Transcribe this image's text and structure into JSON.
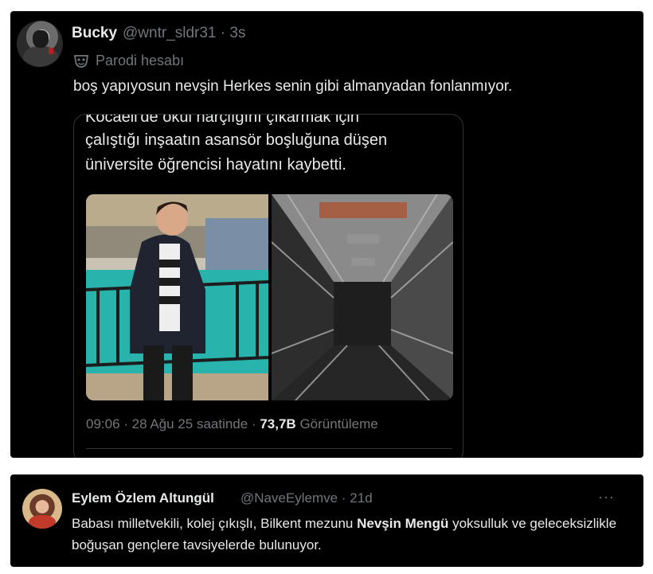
{
  "top_tweet": {
    "author": {
      "name": "Bucky",
      "handle": "@wntr_sldr31",
      "time": "3s"
    },
    "separator": "·",
    "parody_label": "Parodi hesabı",
    "text": "boş yapıyosun nevşin Herkes senin gibi almanyadan fonlanmıyor.",
    "quoted": {
      "lines": [
        "Kocaeli'de okul harçlığını çıkarmak için",
        "çalıştığı inşaatın asansör boşluğuna düşen",
        "üniversite öğrencisi hayatını kaybetti."
      ],
      "meta_time": "09:06 · 28 Ağu 25 saatinde ·",
      "views_count": "73,7B",
      "views_label": "Görüntüleme"
    }
  },
  "bottom_tweet": {
    "author": {
      "name": "Eylem Özlem Altungül",
      "handle": "@NaveEylemve",
      "time": "21d"
    },
    "separator": "·",
    "more_label": "···",
    "text_before": "Babası milletvekili, kolej çıkışlı, Bilkent mezunu ",
    "text_mention": "Nevşin Mengü",
    "text_after": " yoksulluk ve geleceksizlikle boğuşan gençlere tavsiyelerde bulunuyor."
  },
  "colors": {
    "background": "#000000",
    "text": "#e7e9ea",
    "muted": "#71767b",
    "border": "#2f3336"
  }
}
